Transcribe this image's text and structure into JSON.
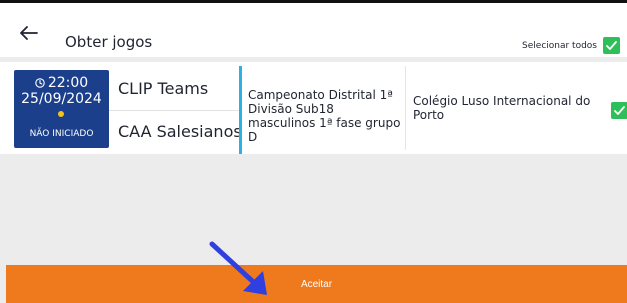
{
  "header": {
    "title": "Obter jogos",
    "select_all_label": "Selecionar todos",
    "select_all_checked": true
  },
  "games": [
    {
      "time": "22:00",
      "date": "25/09/2024",
      "status": "NÃO INICIADO",
      "home_team": "CLIP Teams",
      "away_team": "CAA Salesianos",
      "competition": "Campeonato Distrital 1ª Divisão Sub18 masculinos 1ª fase grupo D",
      "venue": "Colégio Luso Internacional do Porto",
      "checked": true
    }
  ],
  "footer": {
    "accept_label": "Aceitar"
  },
  "icons": {
    "back": "arrow-left-icon",
    "check": "checkmark-icon",
    "clock": "clock-icon",
    "pointer": "arrow-down-right-icon"
  },
  "colors": {
    "status_card": "#1b3f8a",
    "accent": "#2cb0e6",
    "checkbox": "#2fbf5a",
    "accept_button": "#ef7a1d",
    "pointer_arrow": "#2f3fe0"
  }
}
